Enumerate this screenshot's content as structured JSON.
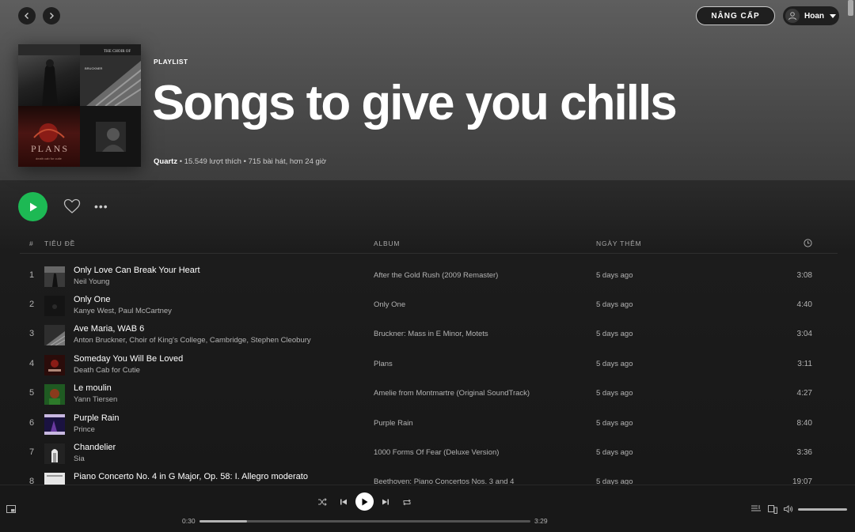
{
  "header": {
    "upgrade_label": "NÂNG CẤP",
    "user_name": "Hoan"
  },
  "playlist": {
    "type_label": "PLAYLIST",
    "title": "Songs to give you chills",
    "owner": "Quartz",
    "meta": " • 15.549 lượt thích • 715 bài hát, hơn 24 giờ"
  },
  "table": {
    "col_num": "#",
    "col_title": "TIÊU ĐỀ",
    "col_album": "ALBUM",
    "col_date": "NGÀY THÊM",
    "col_duration_icon": "clock-icon"
  },
  "tracks": [
    {
      "num": "1",
      "title": "Only Love Can Break Your Heart",
      "artist": "Neil Young",
      "album": "After the Gold Rush (2009 Remaster)",
      "added": "5 days ago",
      "duration": "3:08"
    },
    {
      "num": "2",
      "title": "Only One",
      "artist": "Kanye West, Paul McCartney",
      "album": "Only One",
      "added": "5 days ago",
      "duration": "4:40"
    },
    {
      "num": "3",
      "title": "Ave Maria, WAB 6",
      "artist": "Anton Bruckner, Choir of King's College, Cambridge, Stephen Cleobury",
      "album": "Bruckner: Mass in E Minor, Motets",
      "added": "5 days ago",
      "duration": "3:04"
    },
    {
      "num": "4",
      "title": "Someday You Will Be Loved",
      "artist": "Death Cab for Cutie",
      "album": "Plans",
      "added": "5 days ago",
      "duration": "3:11"
    },
    {
      "num": "5",
      "title": "Le moulin",
      "artist": "Yann Tiersen",
      "album": "Amelie from Montmartre (Original SoundTrack)",
      "added": "5 days ago",
      "duration": "4:27"
    },
    {
      "num": "6",
      "title": "Purple Rain",
      "artist": "Prince",
      "album": "Purple Rain",
      "added": "5 days ago",
      "duration": "8:40"
    },
    {
      "num": "7",
      "title": "Chandelier",
      "artist": "Sia",
      "album": "1000 Forms Of Fear (Deluxe Version)",
      "added": "5 days ago",
      "duration": "3:36"
    },
    {
      "num": "8",
      "title": "Piano Concerto No. 4 in G Major, Op. 58: I. Allegro moderato",
      "artist": "",
      "album": "Beethoven: Piano Concertos Nos. 3 and 4",
      "added": "5 days ago",
      "duration": "19:07"
    }
  ],
  "player": {
    "elapsed": "0:30",
    "total": "3:29",
    "progress": 0.143,
    "volume": 1.0
  },
  "colors": {
    "accent": "#1db954",
    "hero_top": "#5e5e5e",
    "background": "#181818"
  }
}
